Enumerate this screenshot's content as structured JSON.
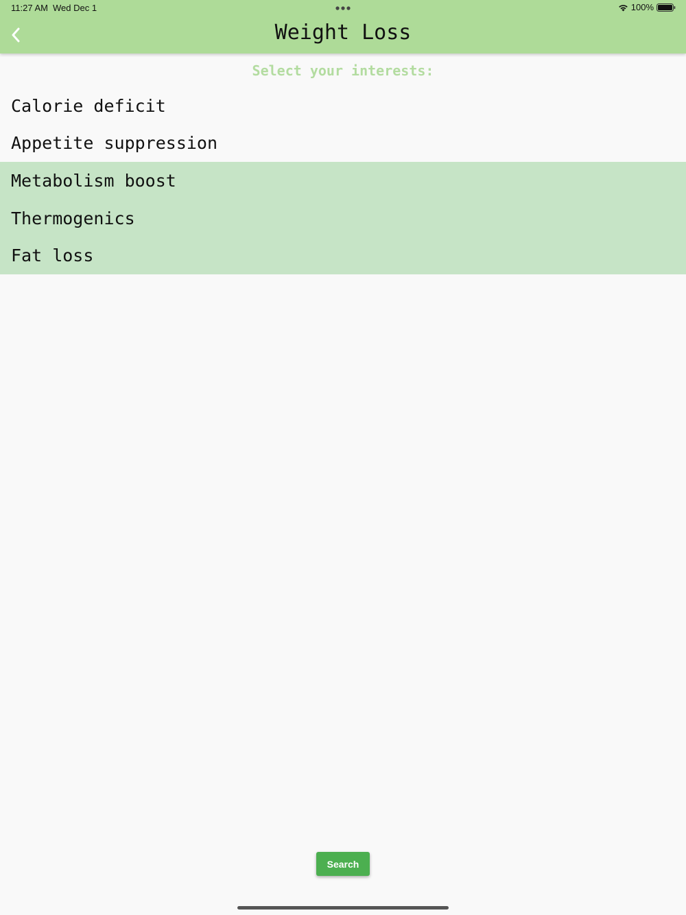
{
  "status_bar": {
    "time": "11:27 AM",
    "date": "Wed Dec 1",
    "battery": "100%"
  },
  "header": {
    "title": "Weight Loss",
    "back_icon": "chevron-left-icon",
    "background_color": "#aedb98"
  },
  "main": {
    "subtitle": "Select your interests:",
    "subtitle_color": "#b3dca0",
    "interests": [
      {
        "label": "Calorie deficit",
        "selected": false
      },
      {
        "label": "Appetite suppression",
        "selected": false
      },
      {
        "label": "Metabolism boost",
        "selected": true
      },
      {
        "label": "Thermogenics",
        "selected": true
      },
      {
        "label": "Fat loss",
        "selected": true
      }
    ],
    "selected_color": "#c6e4c6"
  },
  "footer": {
    "search_label": "Search",
    "search_color": "#4caf50"
  }
}
